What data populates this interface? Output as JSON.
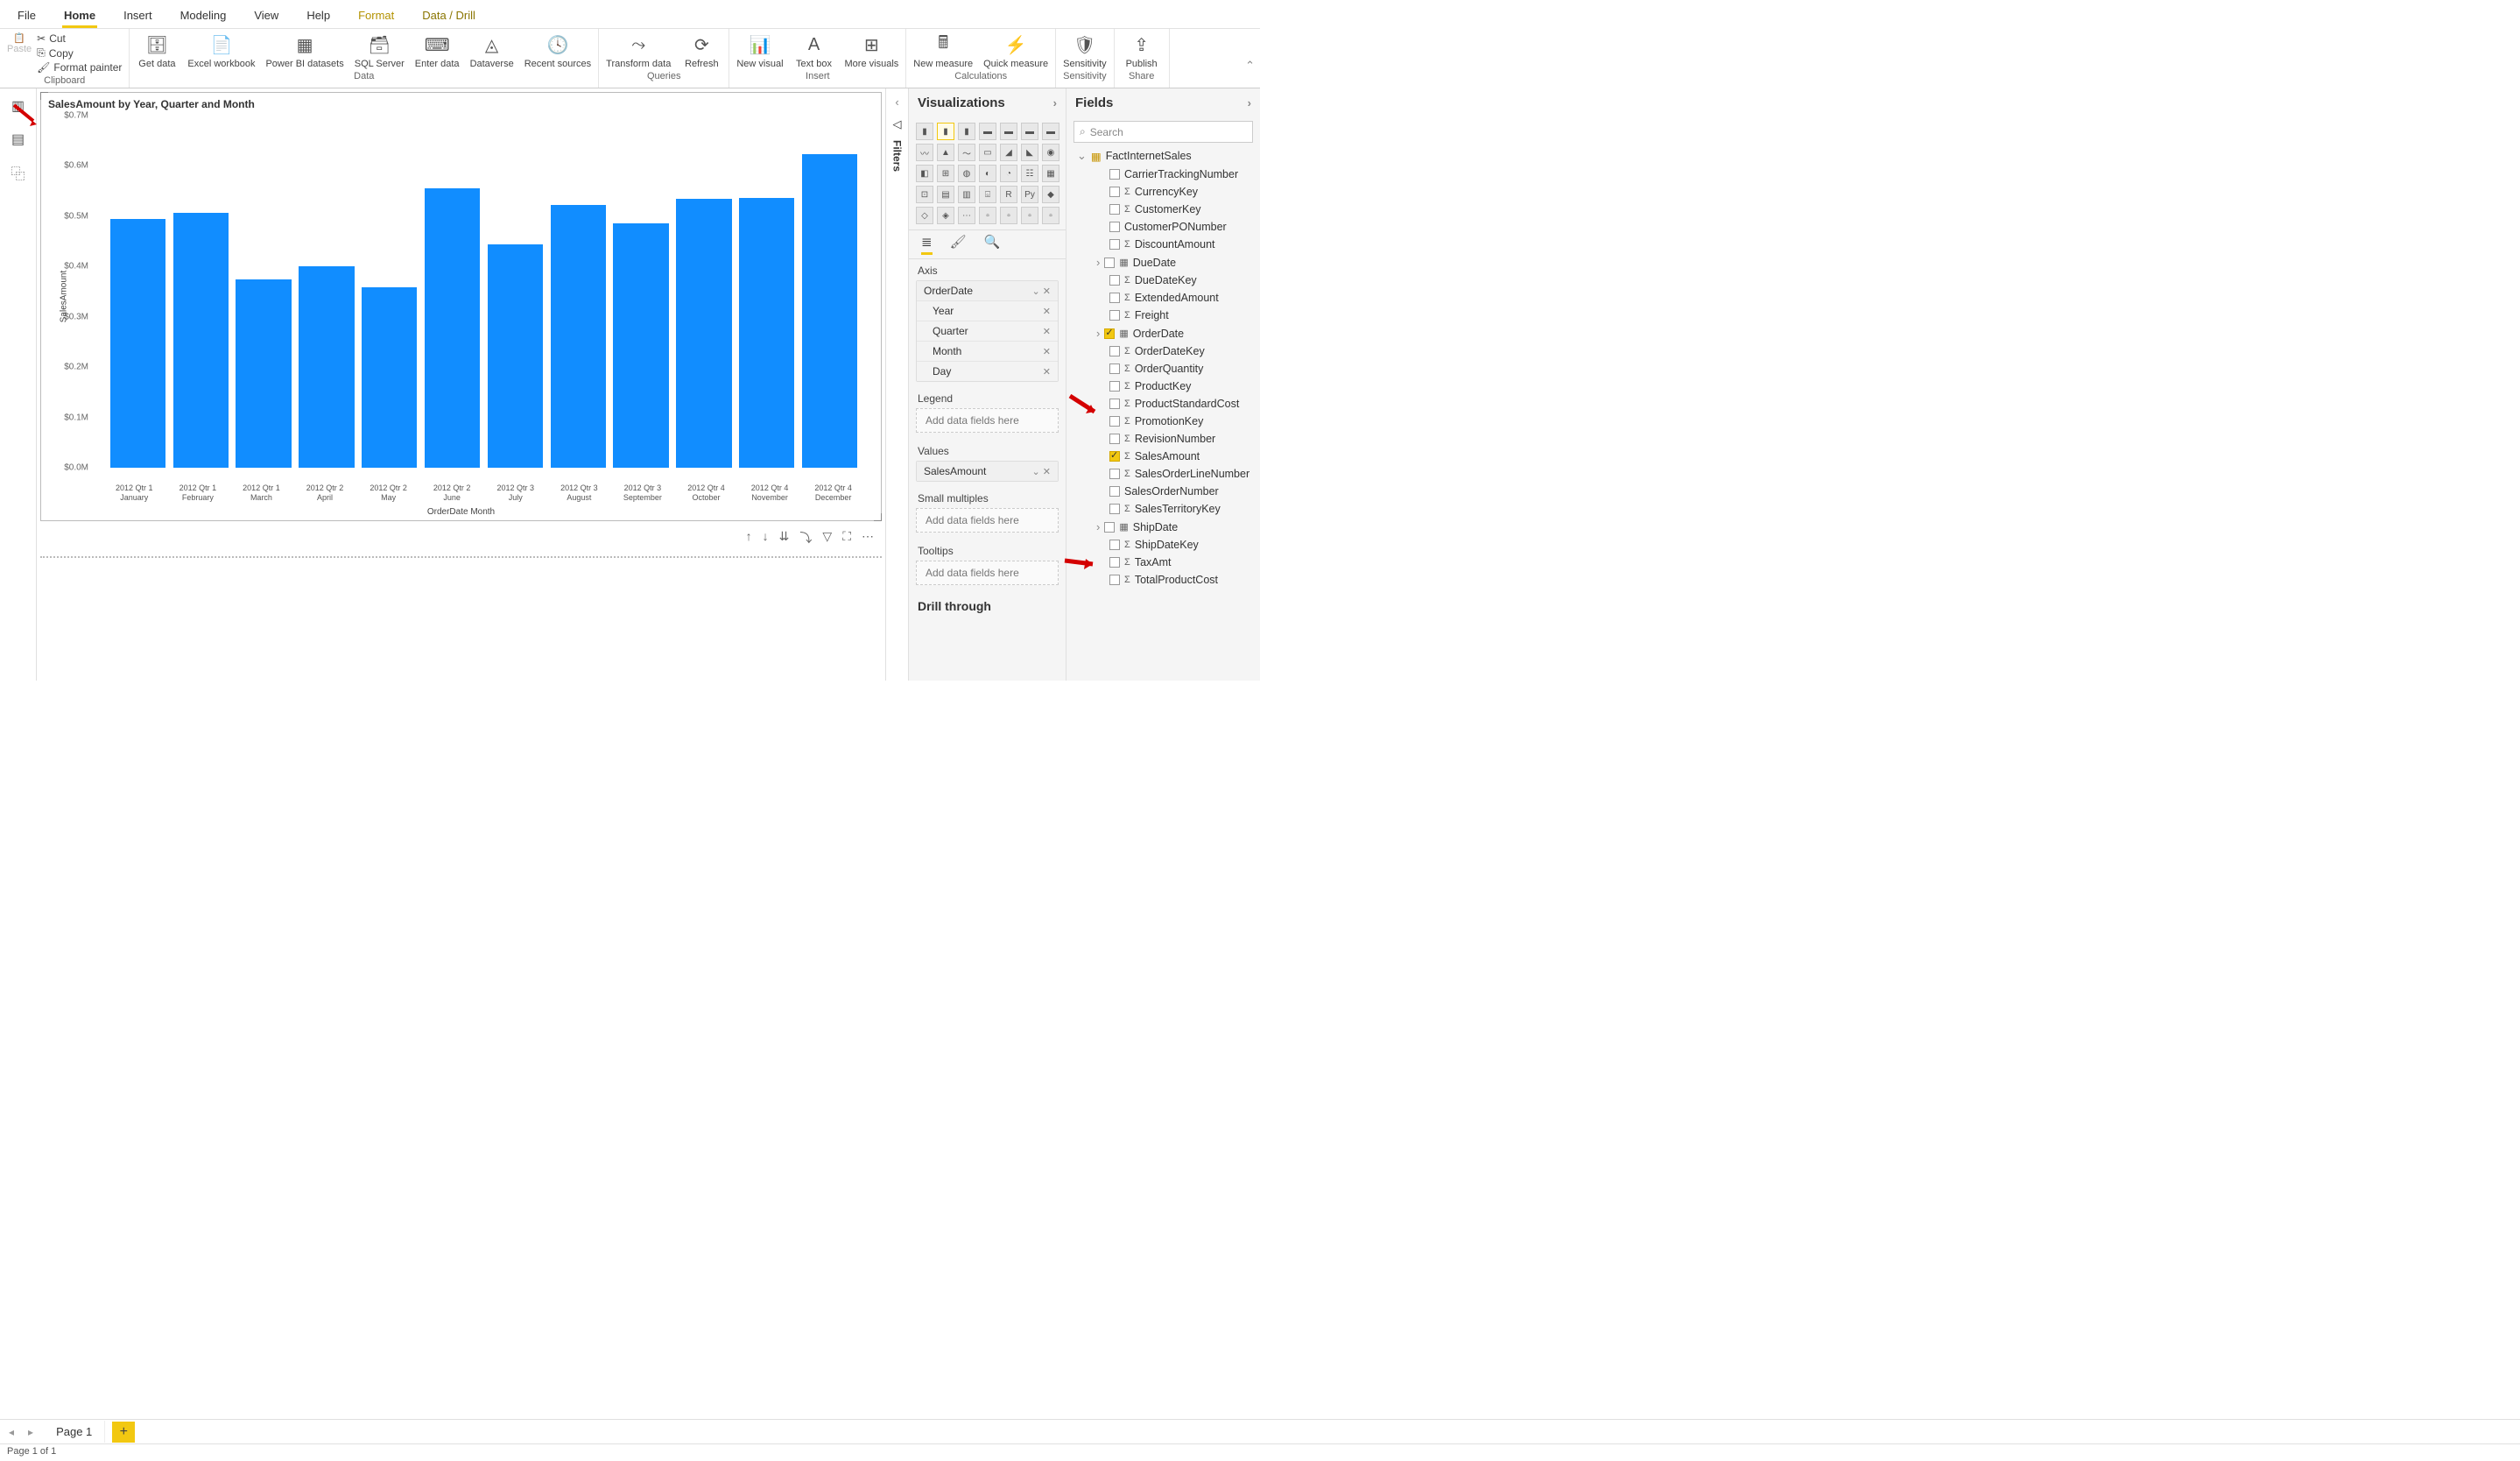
{
  "menu": {
    "file": "File",
    "home": "Home",
    "insert": "Insert",
    "modeling": "Modeling",
    "view": "View",
    "help": "Help",
    "format": "Format",
    "datadrill": "Data / Drill"
  },
  "clipboard": {
    "paste": "Paste",
    "cut": "Cut",
    "copy": "Copy",
    "fmt": "Format painter",
    "group": "Clipboard"
  },
  "datagrp": {
    "getdata": "Get data",
    "excel": "Excel workbook",
    "pbi": "Power BI datasets",
    "sql": "SQL Server",
    "enter": "Enter data",
    "dv": "Dataverse",
    "recent": "Recent sources",
    "group": "Data"
  },
  "queries": {
    "transform": "Transform data",
    "refresh": "Refresh",
    "group": "Queries"
  },
  "insertgrp": {
    "newv": "New visual",
    "text": "Text box",
    "more": "More visuals",
    "group": "Insert"
  },
  "calc": {
    "newm": "New measure",
    "quick": "Quick measure",
    "group": "Calculations"
  },
  "sens": {
    "label": "Sensitivity",
    "group": "Sensitivity"
  },
  "share": {
    "publish": "Publish",
    "group": "Share"
  },
  "pages": {
    "tab": "Page 1",
    "status": "Page 1 of 1"
  },
  "vis": {
    "title": "Visualizations"
  },
  "fields": {
    "title": "Fields",
    "search": "Search"
  },
  "filters": "Filters",
  "chart_data": {
    "type": "bar",
    "title": "SalesAmount by Year, Quarter and Month",
    "xlabel": "OrderDate Month",
    "ylabel": "SalesAmount",
    "ylim": [
      0,
      0.7
    ],
    "yticks": [
      "$0.0M",
      "$0.1M",
      "$0.2M",
      "$0.3M",
      "$0.4M",
      "$0.5M",
      "$0.6M",
      "$0.7M"
    ],
    "categories": [
      "2012 Qtr 1 January",
      "2012 Qtr 1 February",
      "2012 Qtr 1 March",
      "2012 Qtr 2 April",
      "2012 Qtr 2 May",
      "2012 Qtr 2 June",
      "2012 Qtr 3 July",
      "2012 Qtr 3 August",
      "2012 Qtr 3 September",
      "2012 Qtr 4 October",
      "2012 Qtr 4 November",
      "2012 Qtr 4 December"
    ],
    "values": [
      0.495,
      0.506,
      0.375,
      0.4,
      0.358,
      0.555,
      0.444,
      0.523,
      0.486,
      0.535,
      0.537,
      0.624
    ]
  },
  "wells": {
    "axis": "Axis",
    "axis_items": [
      "OrderDate",
      "Year",
      "Quarter",
      "Month",
      "Day"
    ],
    "legend": "Legend",
    "values": "Values",
    "values_items": [
      "SalesAmount"
    ],
    "small": "Small multiples",
    "tooltips": "Tooltips",
    "placeholder": "Add data fields here",
    "drill": "Drill through"
  },
  "tree": {
    "table": "FactInternetSales",
    "cols": [
      {
        "n": "CarrierTrackingNumber",
        "sig": false
      },
      {
        "n": "CurrencyKey",
        "sig": true
      },
      {
        "n": "CustomerKey",
        "sig": true
      },
      {
        "n": "CustomerPONumber",
        "sig": false
      },
      {
        "n": "DiscountAmount",
        "sig": true
      },
      {
        "n": "DueDate",
        "cal": true,
        "exp": true
      },
      {
        "n": "DueDateKey",
        "sig": true
      },
      {
        "n": "ExtendedAmount",
        "sig": true
      },
      {
        "n": "Freight",
        "sig": true
      },
      {
        "n": "OrderDate",
        "cal": true,
        "exp": true,
        "chk": true
      },
      {
        "n": "OrderDateKey",
        "sig": true
      },
      {
        "n": "OrderQuantity",
        "sig": true
      },
      {
        "n": "ProductKey",
        "sig": true
      },
      {
        "n": "ProductStandardCost",
        "sig": true
      },
      {
        "n": "PromotionKey",
        "sig": true
      },
      {
        "n": "RevisionNumber",
        "sig": true
      },
      {
        "n": "SalesAmount",
        "sig": true,
        "chk": true
      },
      {
        "n": "SalesOrderLineNumber",
        "sig": true
      },
      {
        "n": "SalesOrderNumber",
        "sig": false
      },
      {
        "n": "SalesTerritoryKey",
        "sig": true
      },
      {
        "n": "ShipDate",
        "cal": true,
        "exp": true
      },
      {
        "n": "ShipDateKey",
        "sig": true
      },
      {
        "n": "TaxAmt",
        "sig": true
      },
      {
        "n": "TotalProductCost",
        "sig": true
      }
    ]
  }
}
